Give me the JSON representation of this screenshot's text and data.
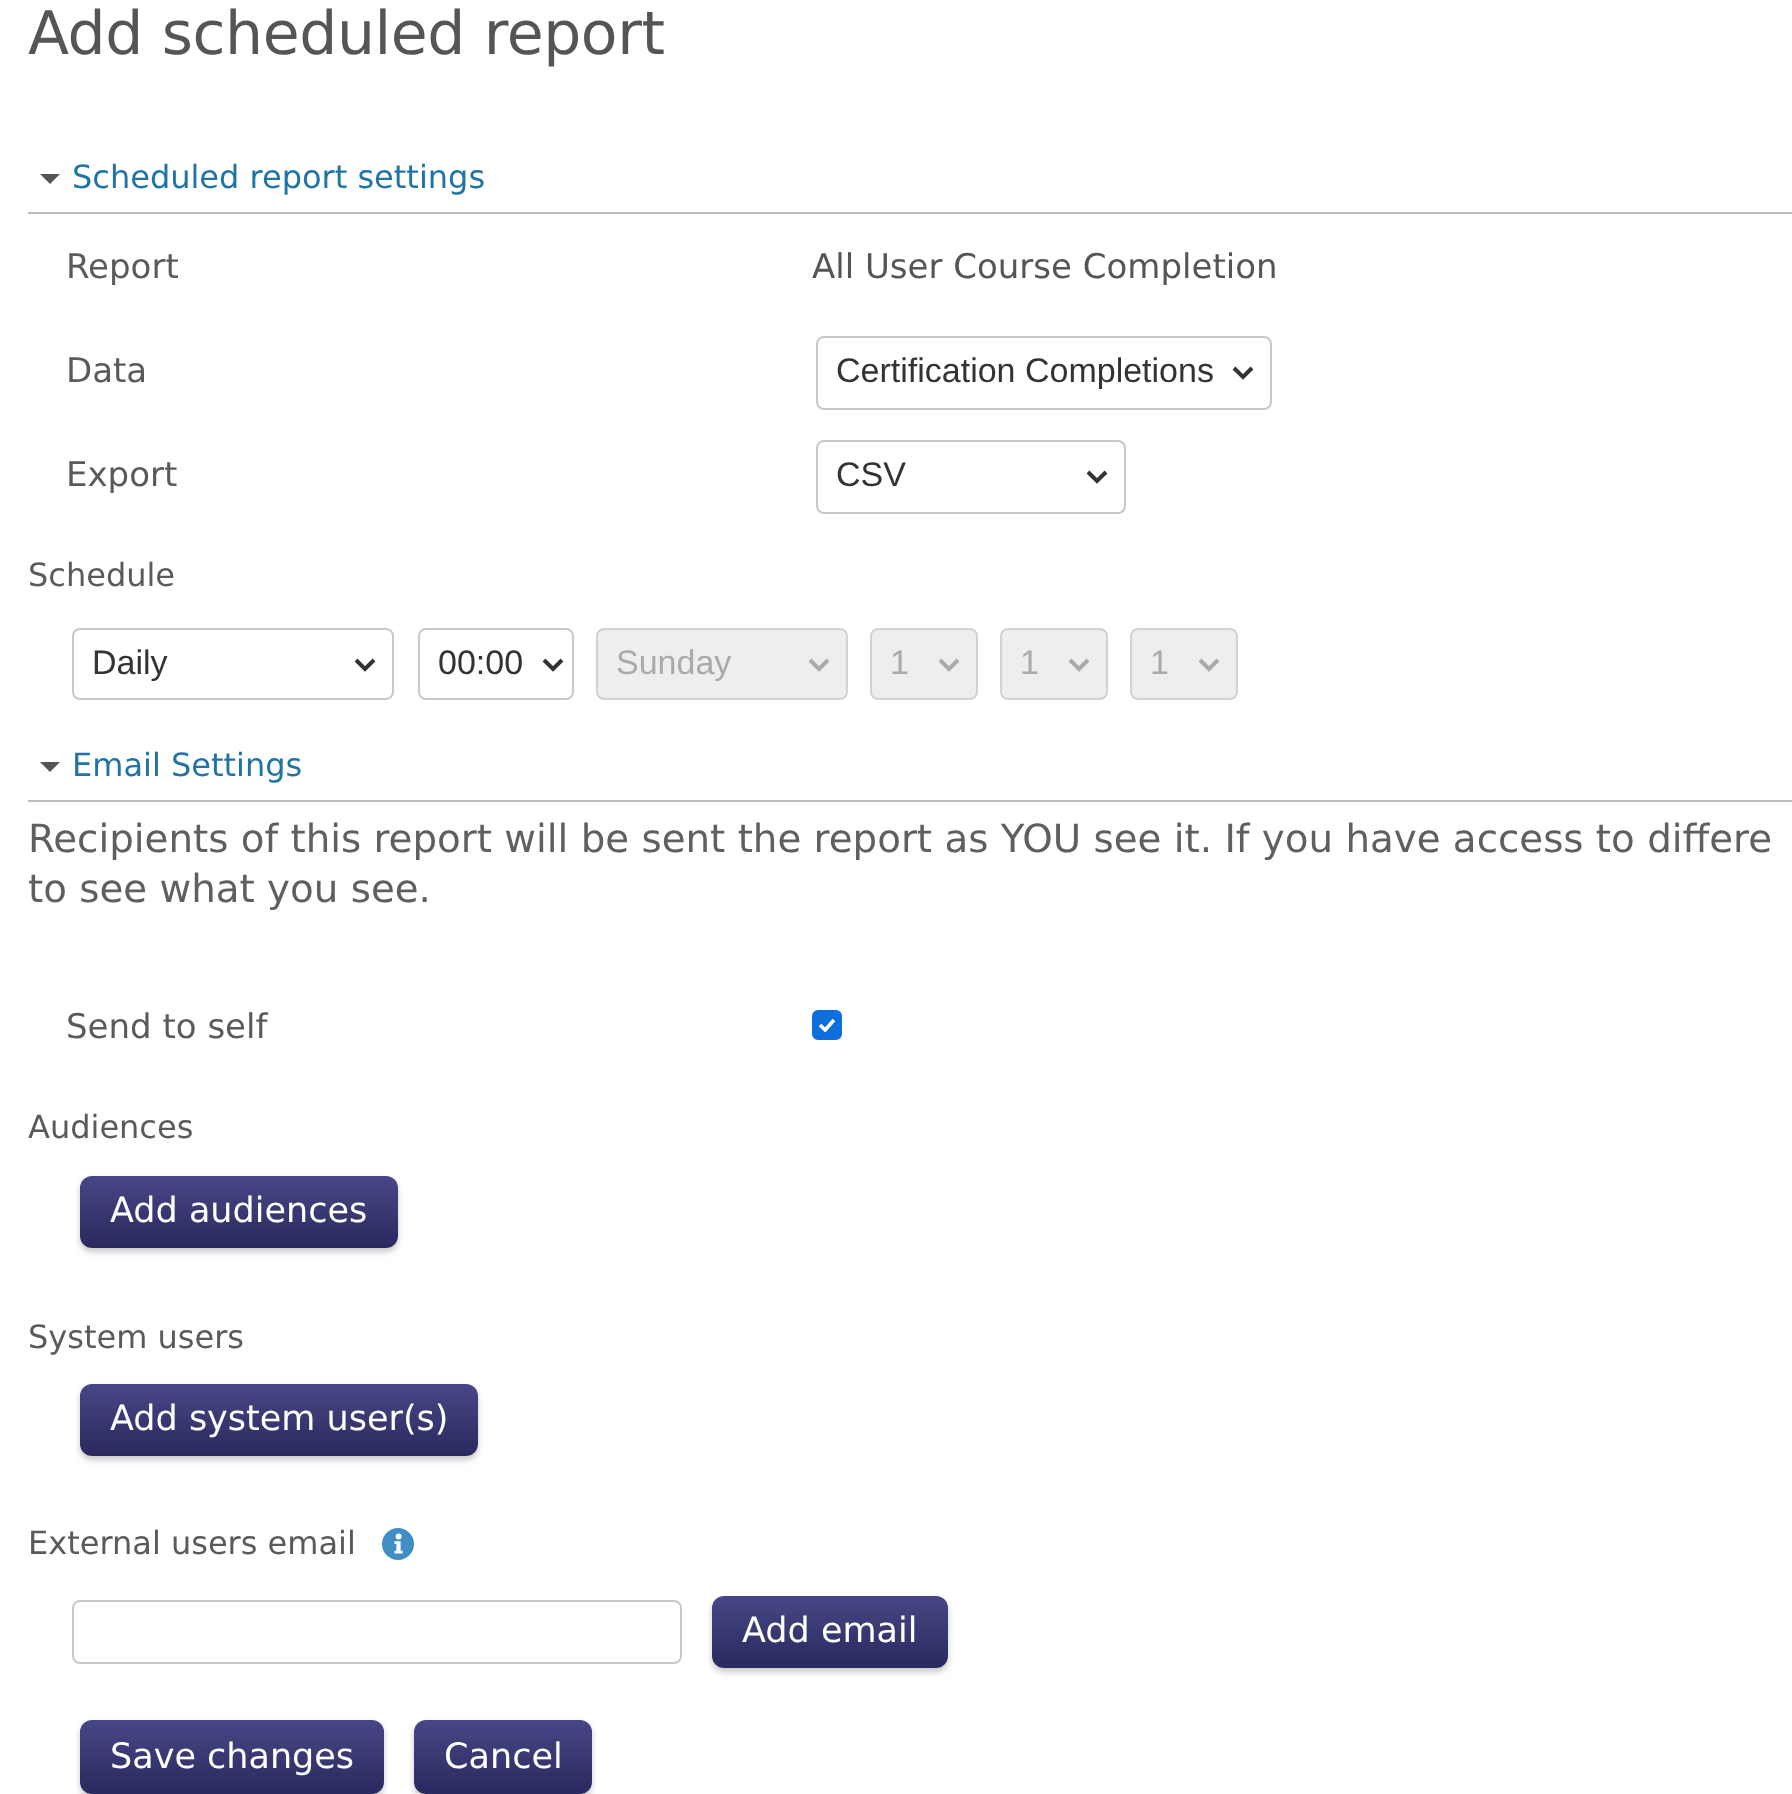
{
  "title": "Add scheduled report",
  "report_settings": {
    "heading": "Scheduled report settings",
    "expanded": true,
    "fields": [
      {
        "kind": "text",
        "label": "Report",
        "value": "All User Course Completion"
      },
      {
        "kind": "select",
        "label": "Data",
        "value": "Certification Completions"
      },
      {
        "kind": "select",
        "label": "Export",
        "value": "CSV"
      }
    ]
  },
  "schedule": {
    "label": "Schedule",
    "selects": [
      {
        "value": "Daily",
        "disabled": false
      },
      {
        "value": "00:00",
        "disabled": false
      },
      {
        "value": "Sunday",
        "disabled": true
      },
      {
        "value": "1",
        "disabled": true
      },
      {
        "value": "1",
        "disabled": true
      },
      {
        "value": "1",
        "disabled": true
      }
    ]
  },
  "email_settings": {
    "heading": "Email Settings",
    "expanded": true,
    "notice_lines": [
      "Recipients of this report will be sent the report as YOU see it. If you have access to differe",
      "to see what you see."
    ],
    "send_to_self": {
      "label": "Send to self",
      "checked": true
    },
    "audiences": {
      "label": "Audiences",
      "button": "Add audiences"
    },
    "system_users": {
      "label": "System users",
      "button": "Add system user(s)"
    },
    "external_email": {
      "label": "External users email",
      "button": "Add email"
    }
  },
  "buttons": [
    "Save changes",
    "Cancel"
  ]
}
